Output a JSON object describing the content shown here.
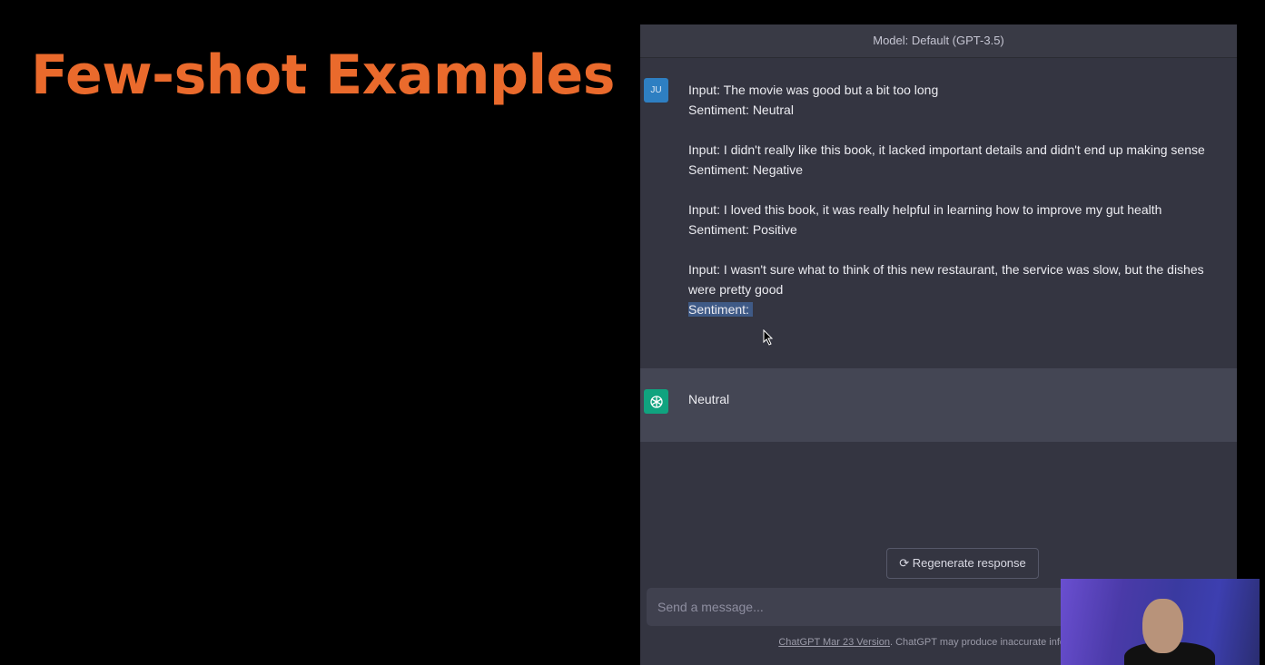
{
  "slide": {
    "title": "Few-shot Examples"
  },
  "chat": {
    "header": "Model: Default (GPT-3.5)",
    "user": {
      "avatar": "JU",
      "lines": [
        "Input: The movie was good but a bit too long",
        "Sentiment: Neutral",
        "Input: I didn't really like this book, it lacked important details and didn't end up making sense",
        "Sentiment: Negative",
        "Input: I loved this book, it was really helpful in learning how to improve my gut health",
        "Sentiment: Positive",
        "Input: I wasn't sure what to think of this new restaurant, the service was slow, but the dishes were pretty good",
        "Sentiment:"
      ]
    },
    "assistant": {
      "icon": "openai-logo-icon",
      "text": "Neutral"
    },
    "regenerate_label": "Regenerate response",
    "input_placeholder": "Send a message...",
    "footer_link": "ChatGPT Mar 23 Version",
    "footer_text": ". ChatGPT may produce inaccurate information"
  },
  "colors": {
    "title": "#ea6a2c",
    "user_avatar": "#2e7fc2",
    "assistant_avatar": "#10a37f"
  }
}
